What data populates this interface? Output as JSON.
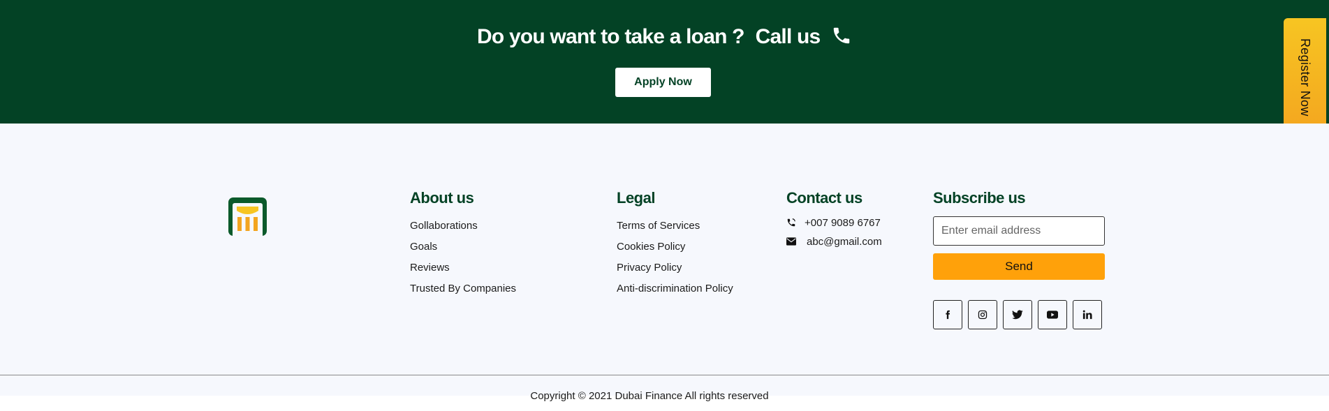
{
  "cta": {
    "question": "Do you want to take a loan ?",
    "call_label": "Call us",
    "apply_label": "Apply Now",
    "phone_icon": "phone-icon"
  },
  "register_tab": {
    "label": "Register Now"
  },
  "footer": {
    "logo_icon": "brand-logo",
    "about": {
      "title": "About us",
      "items": [
        "Gollaborations",
        "Goals",
        "Reviews",
        "Trusted By Companies"
      ]
    },
    "legal": {
      "title": "Legal",
      "items": [
        "Terms of Services",
        "Cookies Policy",
        "Privacy Policy",
        "Anti-discrimination Policy"
      ]
    },
    "contact": {
      "title": "Contact us",
      "phone": "+007 9089 6767",
      "email": "abc@gmail.com"
    },
    "subscribe": {
      "title": "Subscribe us",
      "email_placeholder": "Enter email address",
      "send_label": "Send",
      "socials": [
        "facebook-icon",
        "instagram-icon",
        "twitter-icon",
        "youtube-icon",
        "linkedin-icon"
      ]
    },
    "copyright": "Copyright © 2021 Dubai Finance All rights reserved"
  },
  "colors": {
    "brand_green": "#034225",
    "accent_orange": "#ffa10a",
    "register_yellow": "#f7c522",
    "footer_bg": "#f6f8fd"
  }
}
